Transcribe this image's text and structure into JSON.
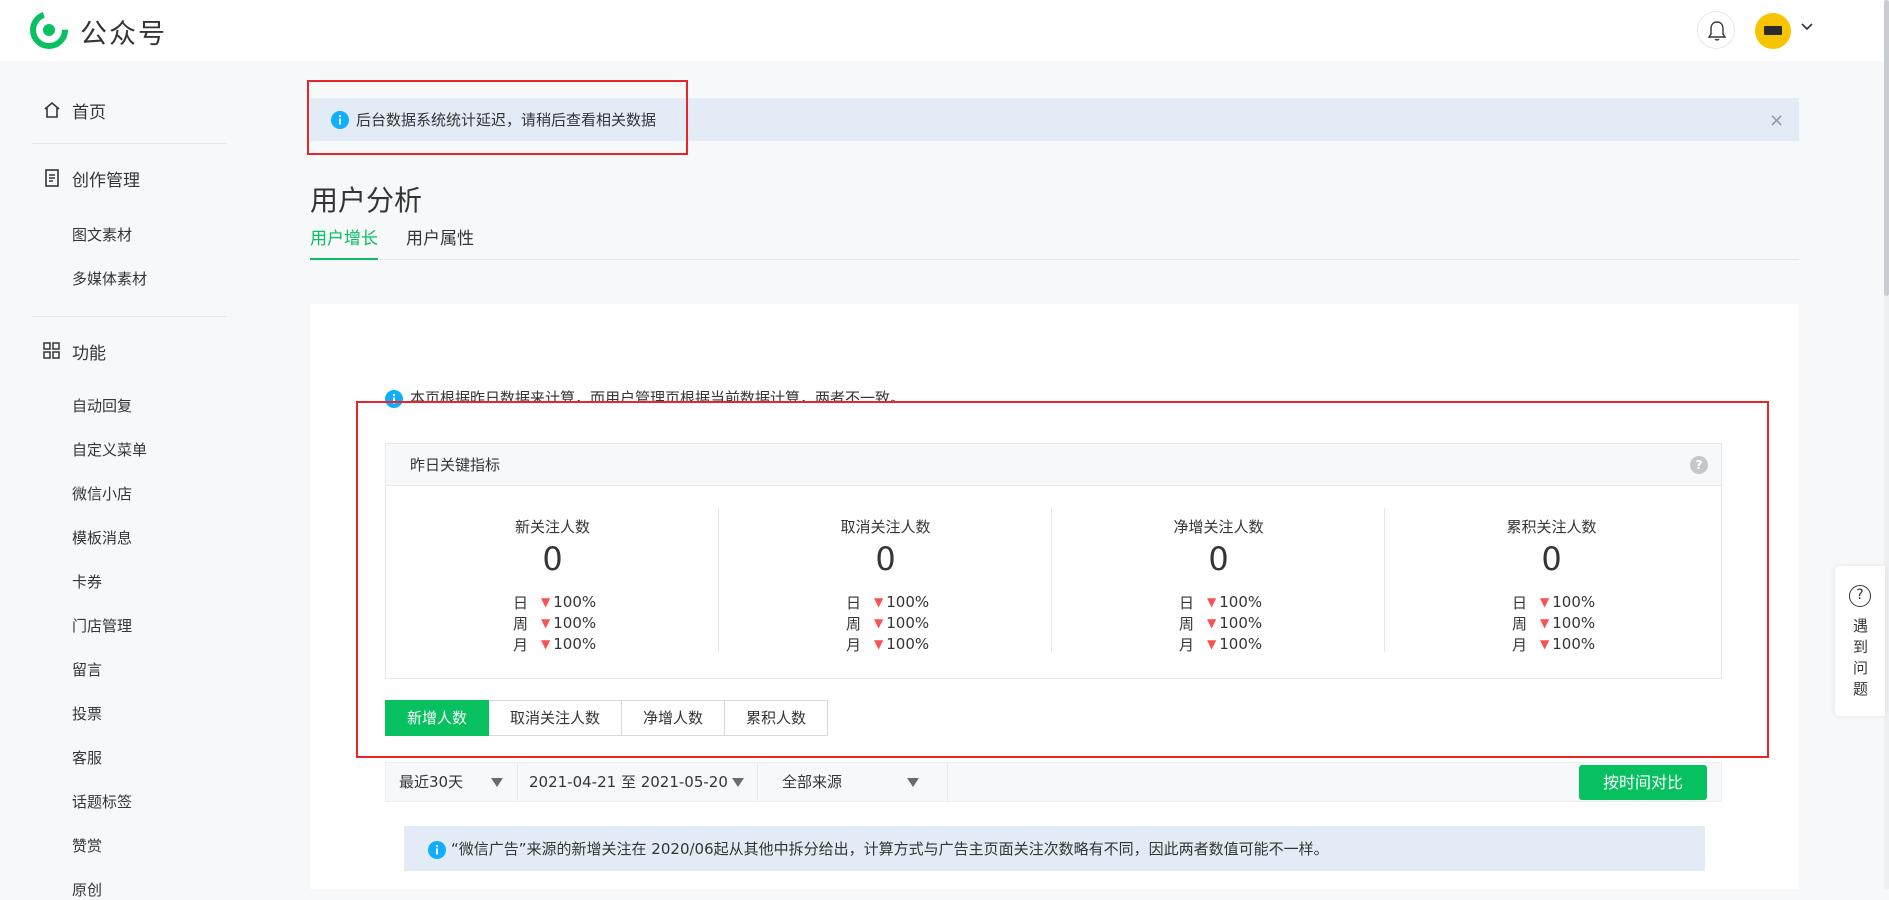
{
  "header": {
    "brand": "公众号"
  },
  "sidebar": {
    "home": "首页",
    "creation": "创作管理",
    "creation_items": [
      "图文素材",
      "多媒体素材"
    ],
    "features": "功能",
    "feature_items": [
      "自动回复",
      "自定义菜单",
      "微信小店",
      "模板消息",
      "卡券",
      "门店管理",
      "留言",
      "投票",
      "客服",
      "话题标签",
      "赞赏",
      "原创"
    ]
  },
  "notice": {
    "text": "后台数据系统统计延迟，请稍后查看相关数据",
    "close": "×"
  },
  "page": {
    "title": "用户分析",
    "tabs": [
      {
        "label": "用户增长",
        "active": true
      },
      {
        "label": "用户属性",
        "active": false
      }
    ]
  },
  "tip": {
    "text": "本页根据昨日数据来计算，而用户管理页根据当前数据计算，两者不一致。"
  },
  "metrics": {
    "title": "昨日关键指标",
    "help": "?",
    "columns": [
      {
        "label": "新关注人数",
        "value": "0",
        "rows": [
          {
            "k": "日",
            "v": "100%"
          },
          {
            "k": "周",
            "v": "100%"
          },
          {
            "k": "月",
            "v": "100%"
          }
        ]
      },
      {
        "label": "取消关注人数",
        "value": "0",
        "rows": [
          {
            "k": "日",
            "v": "100%"
          },
          {
            "k": "周",
            "v": "100%"
          },
          {
            "k": "月",
            "v": "100%"
          }
        ]
      },
      {
        "label": "净增关注人数",
        "value": "0",
        "rows": [
          {
            "k": "日",
            "v": "100%"
          },
          {
            "k": "周",
            "v": "100%"
          },
          {
            "k": "月",
            "v": "100%"
          }
        ]
      },
      {
        "label": "累积关注人数",
        "value": "0",
        "rows": [
          {
            "k": "日",
            "v": "100%"
          },
          {
            "k": "周",
            "v": "100%"
          },
          {
            "k": "月",
            "v": "100%"
          }
        ]
      }
    ]
  },
  "segments": [
    {
      "label": "新增人数",
      "active": true
    },
    {
      "label": "取消关注人数",
      "active": false
    },
    {
      "label": "净增人数",
      "active": false
    },
    {
      "label": "累积人数",
      "active": false
    }
  ],
  "filters": {
    "period": "最近30天",
    "date_range": "2021-04-21 至 2021-05-20",
    "source": "全部来源",
    "compare_button": "按时间对比"
  },
  "warning": {
    "text": "“微信广告”来源的新增关注在 2020/06起从其他中拆分给出，计算方式与广告主页面关注次数略有不同，因此两者数值可能不一样。"
  },
  "float_help": {
    "text": "遇到问题",
    "icon": "?"
  },
  "colors": {
    "accent": "#07c160",
    "down": "#fa5151",
    "info": "#10aeff",
    "annotation": "#e8262a"
  }
}
